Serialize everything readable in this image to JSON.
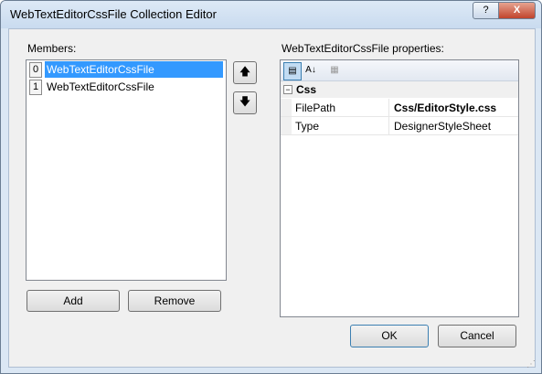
{
  "window": {
    "title": "WebTextEditorCssFile Collection Editor",
    "help_label": "?",
    "close_label": "X"
  },
  "members": {
    "label": "Members:",
    "items": [
      {
        "index": "0",
        "name": "WebTextEditorCssFile",
        "selected": true
      },
      {
        "index": "1",
        "name": "WebTextEditorCssFile",
        "selected": false
      }
    ]
  },
  "move_buttons": {
    "up_label": "🡅",
    "down_label": "🡇",
    "up_icon": "arrow-up-icon",
    "down_icon": "arrow-down-icon"
  },
  "actions": {
    "add_label": "Add",
    "remove_label": "Remove",
    "ok_label": "OK",
    "cancel_label": "Cancel"
  },
  "properties": {
    "label": "WebTextEditorCssFile properties:",
    "toolbar": [
      "categorized-icon",
      "alphabetical-icon",
      "property-pages-icon"
    ],
    "category": {
      "toggle": "−",
      "name": "Css"
    },
    "rows": [
      {
        "name": "FilePath",
        "value": "Css/EditorStyle.css",
        "bold": true
      },
      {
        "name": "Type",
        "value": "DesignerStyleSheet",
        "bold": false
      }
    ]
  },
  "colors": {
    "selection": "#3399ff",
    "close_button": "#c1442c"
  }
}
